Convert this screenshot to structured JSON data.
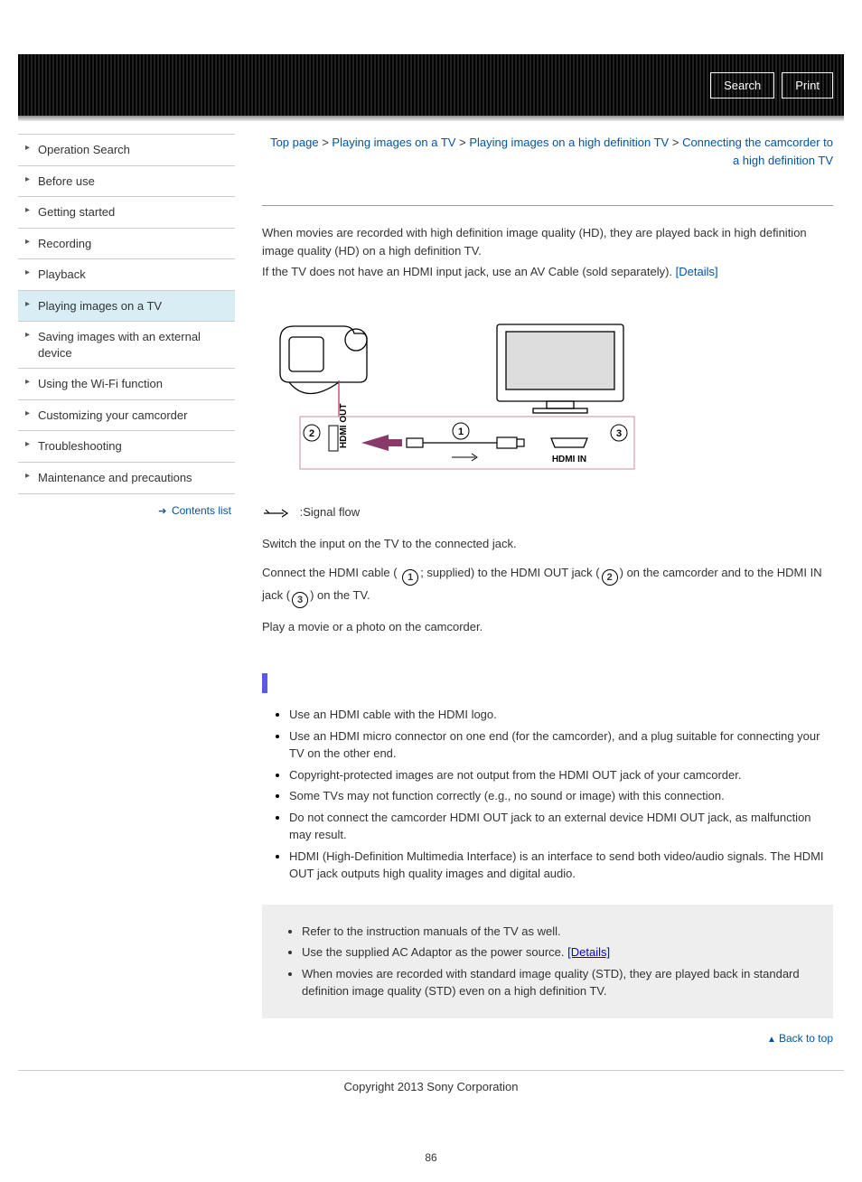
{
  "header": {
    "search": "Search",
    "print": "Print"
  },
  "sidebar": {
    "items": [
      "Operation Search",
      "Before use",
      "Getting started",
      "Recording",
      "Playback",
      "Playing images on a TV",
      "Saving images with an external device",
      "Using the Wi-Fi function",
      "Customizing your camcorder",
      "Troubleshooting",
      "Maintenance and precautions"
    ],
    "active_index": 5,
    "contents_list": "Contents list"
  },
  "breadcrumb": {
    "parts": [
      "Top page",
      "Playing images on a TV",
      "Playing images on a high definition TV",
      "Connecting the camcorder to a high definition TV"
    ],
    "sep": ">"
  },
  "intro": {
    "p1": "When movies are recorded with high definition image quality (HD), they are played back in high definition image quality (HD) on a high definition TV.",
    "p2_pre": "If the TV does not have an HDMI input jack, use an AV Cable (sold separately). ",
    "details": "[Details]"
  },
  "diagram": {
    "hdmi_out": "HDMI OUT",
    "hdmi_in": "HDMI IN",
    "n1": "1",
    "n2": "2",
    "n3": "3"
  },
  "signal_flow_label": ":Signal flow",
  "steps": {
    "s1": "Switch the input on the TV to the connected jack.",
    "s2a": "Connect the HDMI cable ( ",
    "s2b": "; supplied) to the HDMI OUT jack (",
    "s2c": ") on the camcorder and to the HDMI IN jack (",
    "s2d": ") on the TV.",
    "s3": "Play a movie or a photo on the camcorder."
  },
  "notes": [
    "Use an HDMI cable with the HDMI logo.",
    "Use an HDMI micro connector on one end (for the camcorder), and a plug suitable for connecting your TV on the other end.",
    "Copyright-protected images are not output from the HDMI OUT jack of your camcorder.",
    "Some TVs may not function correctly (e.g., no sound or image) with this connection.",
    "Do not connect the camcorder HDMI OUT jack to an external device HDMI OUT jack, as malfunction may result.",
    "HDMI (High-Definition Multimedia Interface) is an interface to send both video/audio signals. The HDMI OUT jack outputs high quality images and digital audio."
  ],
  "tips": {
    "t1": "Refer to the instruction manuals of the TV as well.",
    "t2_pre": "Use the supplied AC Adaptor as the power source. ",
    "t2_link": "[Details]",
    "t3": "When movies are recorded with standard image quality (STD), they are played back in standard definition image quality (STD) even on a high definition TV."
  },
  "back_to_top": "Back to top",
  "copyright": "Copyright 2013 Sony Corporation",
  "page_number": "86"
}
